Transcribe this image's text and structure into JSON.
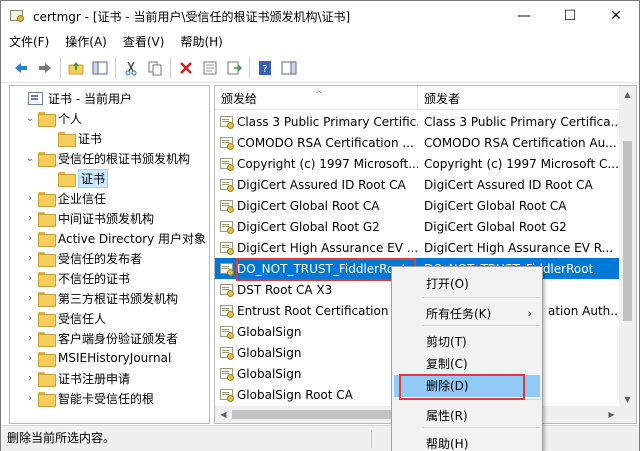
{
  "window": {
    "title": "certmgr - [证书 - 当前用户\\受信任的根证书颁发机构\\证书]",
    "minimize": "—",
    "maximize": "☐",
    "close": "✕"
  },
  "menu": [
    "文件(F)",
    "操作(A)",
    "查看(V)",
    "帮助(H)"
  ],
  "toolbar": {
    "icons": [
      "back-icon",
      "forward-icon",
      "up-folder-icon",
      "show-hide-tree-icon",
      "cut-icon",
      "copy-icon",
      "delete-icon",
      "properties-icon",
      "export-icon",
      "help-icon",
      "action-pane-icon"
    ]
  },
  "tree": [
    {
      "label": "证书 - 当前用户",
      "icon": "cert-root",
      "level": 0,
      "caret": ""
    },
    {
      "label": "个人",
      "icon": "folder",
      "level": 1,
      "caret": "⌄"
    },
    {
      "label": "证书",
      "icon": "folder",
      "level": 2,
      "caret": ""
    },
    {
      "label": "受信任的根证书颁发机构",
      "icon": "folder",
      "level": 1,
      "caret": "⌄"
    },
    {
      "label": "证书",
      "icon": "folder",
      "level": 2,
      "caret": "",
      "selected": true
    },
    {
      "label": "企业信任",
      "icon": "folder",
      "level": 1,
      "caret": "›"
    },
    {
      "label": "中间证书颁发机构",
      "icon": "folder",
      "level": 1,
      "caret": "›"
    },
    {
      "label": "Active Directory 用户对象",
      "icon": "folder",
      "level": 1,
      "caret": "›"
    },
    {
      "label": "受信任的发布者",
      "icon": "folder",
      "level": 1,
      "caret": "›"
    },
    {
      "label": "不信任的证书",
      "icon": "folder",
      "level": 1,
      "caret": "›"
    },
    {
      "label": "第三方根证书颁发机构",
      "icon": "folder",
      "level": 1,
      "caret": "›"
    },
    {
      "label": "受信任人",
      "icon": "folder",
      "level": 1,
      "caret": "›"
    },
    {
      "label": "客户端身份验证颁发者",
      "icon": "folder",
      "level": 1,
      "caret": "›"
    },
    {
      "label": "MSIEHistoryJournal",
      "icon": "folder",
      "level": 1,
      "caret": "›"
    },
    {
      "label": "证书注册申请",
      "icon": "folder",
      "level": 1,
      "caret": "›"
    },
    {
      "label": "智能卡受信任的根",
      "icon": "folder",
      "level": 1,
      "caret": "›"
    }
  ],
  "list": {
    "columns": [
      "颁发给",
      "颁发者"
    ],
    "sort_indicator": "^",
    "rows": [
      {
        "issued_to": "Class 3 Public Primary Certific...",
        "issued_by": "Class 3 Public Primary Certifica..."
      },
      {
        "issued_to": "COMODO RSA Certification ...",
        "issued_by": "COMODO RSA Certification Au..."
      },
      {
        "issued_to": "Copyright (c) 1997 Microsoft...",
        "issued_by": "Copyright (c) 1997 Microsoft C..."
      },
      {
        "issued_to": "DigiCert Assured ID Root CA",
        "issued_by": "DigiCert Assured ID Root CA"
      },
      {
        "issued_to": "DigiCert Global Root CA",
        "issued_by": "DigiCert Global Root CA"
      },
      {
        "issued_to": "DigiCert Global Root G2",
        "issued_by": "DigiCert Global Root G2"
      },
      {
        "issued_to": "DigiCert High Assurance EV ...",
        "issued_by": "DigiCert High Assurance EV R..."
      },
      {
        "issued_to": "DO_NOT_TRUST_FiddlerRoot",
        "issued_by": "DO_NOT_TRUST_FiddlerRoot",
        "selected": true
      },
      {
        "issued_to": "DST Root CA X3",
        "issued_by": ""
      },
      {
        "issued_to": "Entrust Root Certification A",
        "issued_by": "ation Auth..."
      },
      {
        "issued_to": "GlobalSign",
        "issued_by": ""
      },
      {
        "issued_to": "GlobalSign",
        "issued_by": ""
      },
      {
        "issued_to": "GlobalSign",
        "issued_by": ""
      },
      {
        "issued_to": "GlobalSign Root CA",
        "issued_by": ""
      }
    ]
  },
  "context_menu": {
    "items": [
      {
        "label": "打开(O)"
      },
      {
        "label": "所有任务(K)",
        "submenu_arrow": "›"
      },
      {
        "label": "剪切(T)"
      },
      {
        "label": "复制(C)"
      },
      {
        "label": "删除(D)",
        "highlighted": true
      },
      {
        "label": "属性(R)"
      },
      {
        "label": "帮助(H)"
      }
    ]
  },
  "status_bar": {
    "text": "删除当前所选内容。"
  },
  "colors": {
    "selection": "#0078d7",
    "annotation_box": "#e53935",
    "menu_highlight": "#91c9f7"
  }
}
